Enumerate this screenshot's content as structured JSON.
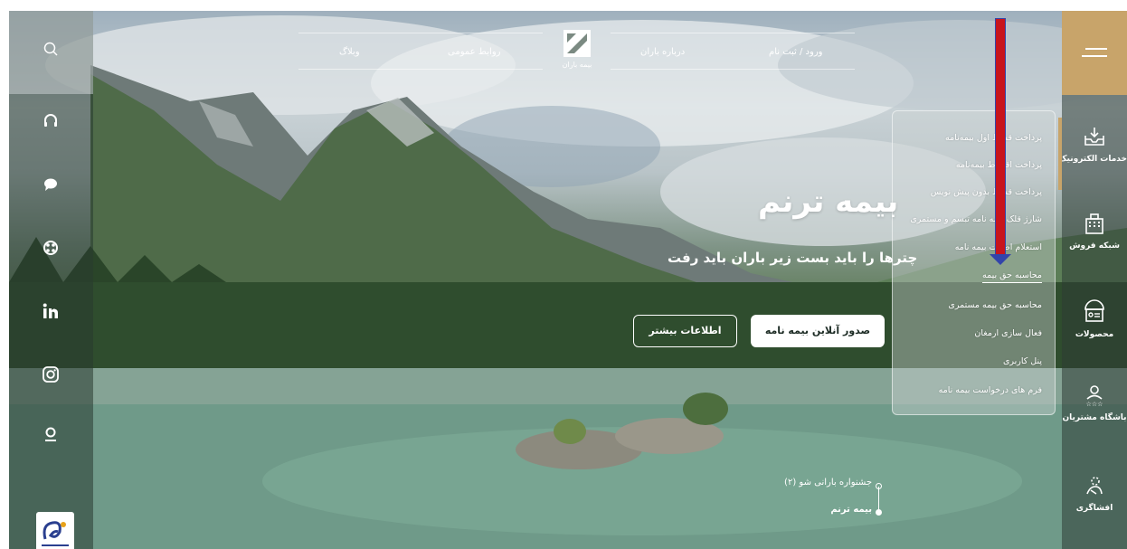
{
  "topnav": {
    "login_label": "ورود / ثبت نام",
    "about_label": "درباره باران",
    "brand_caption": "بیمه باران",
    "pr_label": "روابط عمومی",
    "blog_label": "وبلاگ"
  },
  "dropdown": {
    "items": [
      "پرداخت قسط اول بیمه‌نامه",
      "پرداخت اقساط بیمه‌نامه",
      "پرداخت قسط بدون پیش نویس",
      "شارژ قلک بیمه نامه تبسم و مستمری",
      "استعلام اصالت بیمه نامه",
      "محاسبه حق بیمه",
      "محاسبه حق بیمه مستمری",
      "فعال سازی ارمغان",
      "پنل کاربری",
      "فرم های درخواست بیمه نامه"
    ],
    "active_item": "محاسبه حق بیمه"
  },
  "hero": {
    "title": "بیمه ترنم",
    "subtitle": "چترها را باید بست زیر باران باید رفت",
    "primary_button": "صدور آنلاین بیمه نامه",
    "secondary_button": "اطلاعات بیشتر"
  },
  "pager": {
    "items": [
      "جشنواره بارانی شو (۲)",
      "بیمه ترنم"
    ],
    "active_index": 1
  },
  "rightbar": {
    "items": [
      {
        "label": "خدمات الکترونیک",
        "icon": "download-tray-icon"
      },
      {
        "label": "شبکه فروش",
        "icon": "building-icon"
      },
      {
        "label": "محصولات",
        "icon": "umbrella-card-icon"
      },
      {
        "label": "باشگاه مشتریان",
        "icon": "user-stars-icon"
      },
      {
        "label": "افشاگری",
        "icon": "whistle-icon"
      }
    ]
  },
  "leftbar": {
    "icons": [
      "search-icon",
      "headset-icon",
      "chat-icon",
      "aparat-icon",
      "linkedin-icon",
      "instagram-icon",
      "location-icon"
    ]
  },
  "colors": {
    "accent": "#c8a46a",
    "arrow": "#c8141c",
    "arrow_border": "#3344aa"
  }
}
